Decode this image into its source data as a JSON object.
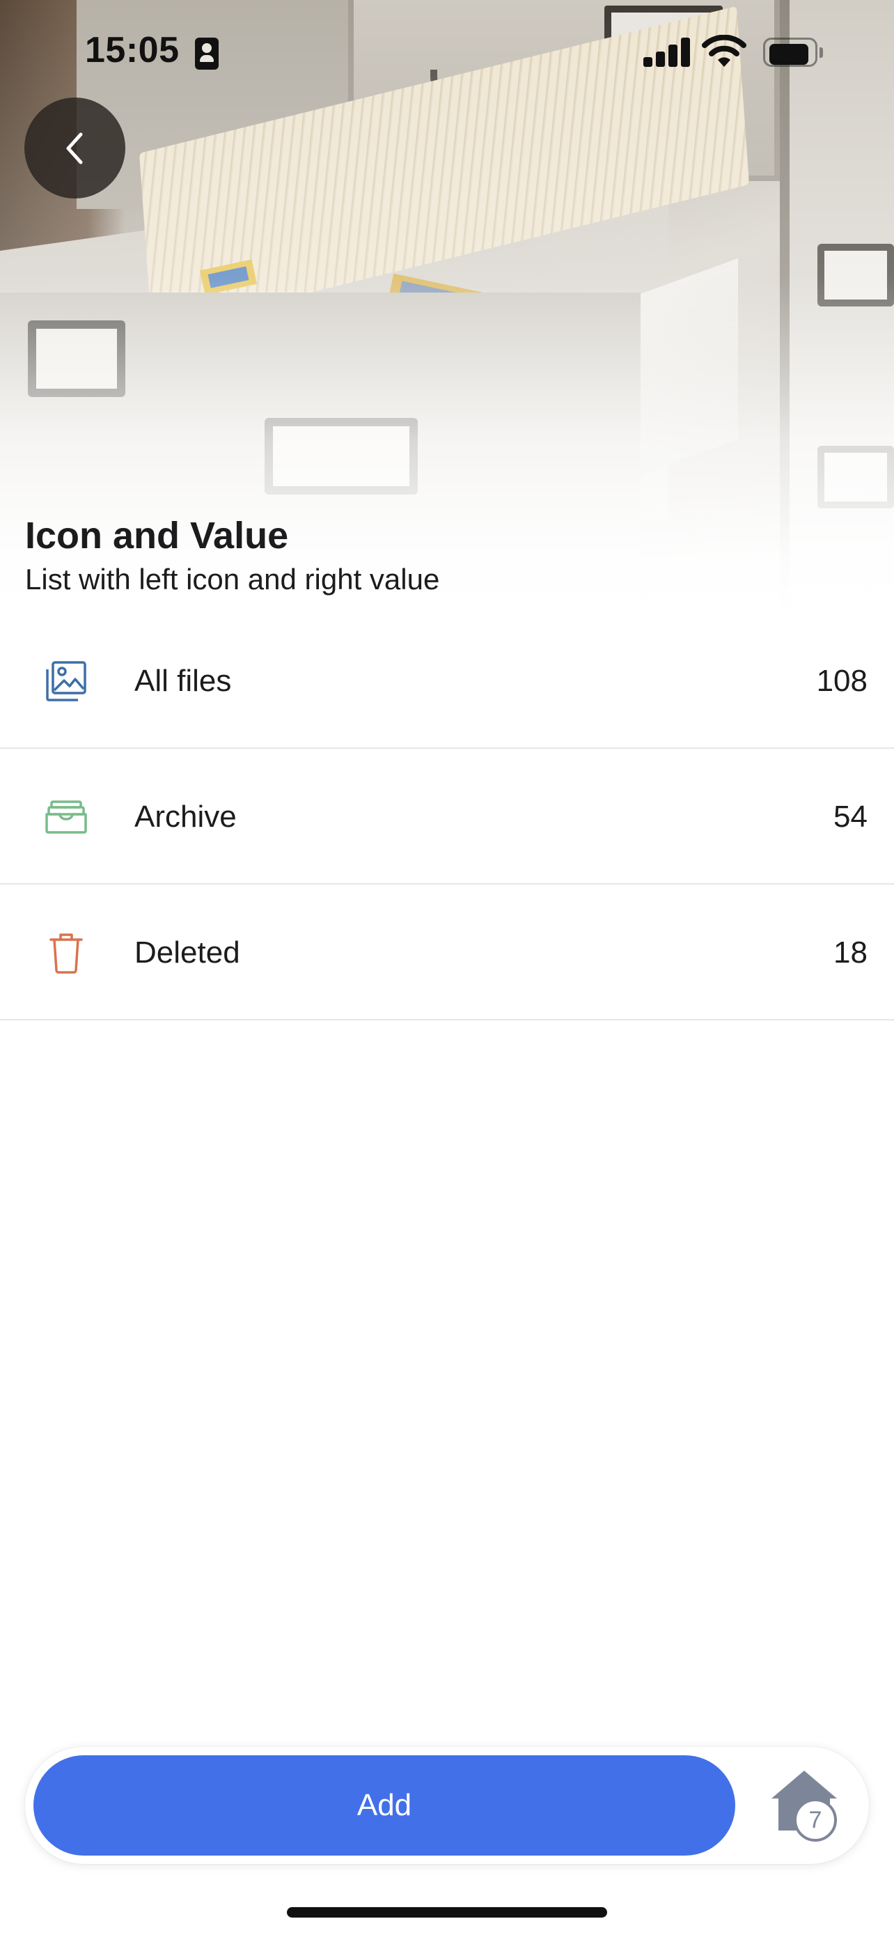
{
  "status_bar": {
    "time": "15:05",
    "signal_bars": 4,
    "battery_level": 0.85,
    "icons": [
      "portrait-icon",
      "signal-icon",
      "wifi-icon",
      "battery-icon"
    ]
  },
  "header": {
    "back_icon": "chevron-left-icon",
    "title": "Icon and Value",
    "subtitle": "List with left icon and right value"
  },
  "list": {
    "items": [
      {
        "icon": "image-gallery-icon",
        "icon_color": "#3d6fa8",
        "label": "All files",
        "value": "108"
      },
      {
        "icon": "archive-tray-icon",
        "icon_color": "#79bb8a",
        "label": "Archive",
        "value": "54"
      },
      {
        "icon": "trash-icon",
        "icon_color": "#d9734e",
        "label": "Deleted",
        "value": "18"
      }
    ]
  },
  "bottom_bar": {
    "add_label": "Add",
    "home_icon": "home-icon",
    "home_badge": "7"
  },
  "colors": {
    "accent": "#4270e8",
    "text": "#1c1c1e",
    "divider": "#e7e7ea",
    "home_icon": "#7d8699"
  }
}
